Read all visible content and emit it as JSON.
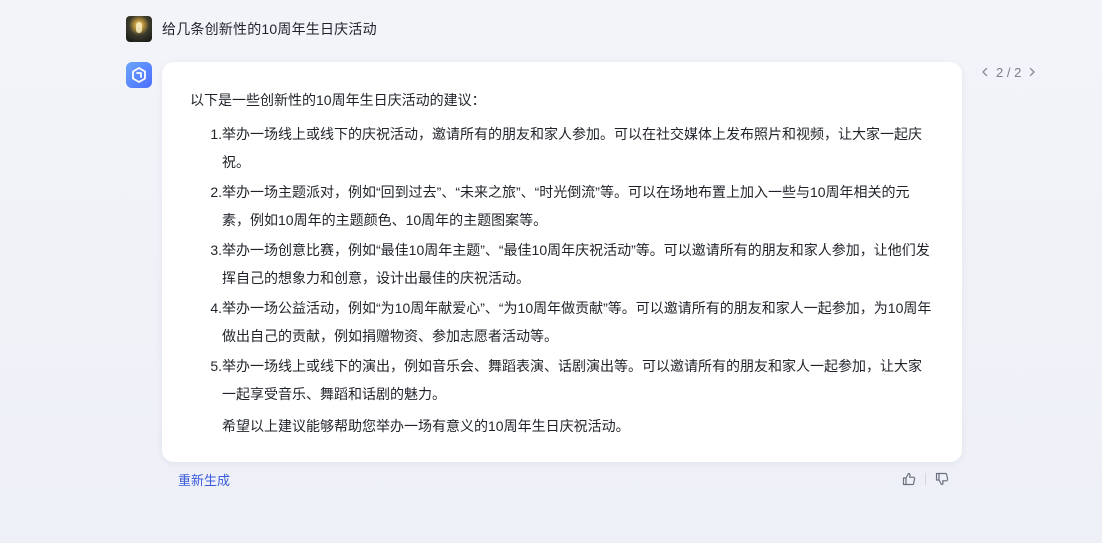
{
  "user_message": {
    "text": "给几条创新性的10周年生日庆活动"
  },
  "answer": {
    "intro": "以下是一些创新性的10周年生日庆活动的建议：",
    "items": [
      {
        "num": "1.",
        "text": "举办一场线上或线下的庆祝活动，邀请所有的朋友和家人参加。可以在社交媒体上发布照片和视频，让大家一起庆祝。"
      },
      {
        "num": "2.",
        "text": "举办一场主题派对，例如“回到过去”、“未来之旅”、“时光倒流”等。可以在场地布置上加入一些与10周年相关的元素，例如10周年的主题颜色、10周年的主题图案等。"
      },
      {
        "num": "3.",
        "text": "举办一场创意比赛，例如“最佳10周年主题”、“最佳10周年庆祝活动”等。可以邀请所有的朋友和家人参加，让他们发挥自己的想象力和创意，设计出最佳的庆祝活动。"
      },
      {
        "num": "4.",
        "text": "举办一场公益活动，例如“为10周年献爱心”、“为10周年做贡献”等。可以邀请所有的朋友和家人一起参加，为10周年做出自己的贡献，例如捐赠物资、参加志愿者活动等。"
      },
      {
        "num": "5.",
        "text": "举办一场线上或线下的演出，例如音乐会、舞蹈表演、话剧演出等。可以邀请所有的朋友和家人一起参加，让大家一起享受音乐、舞蹈和话剧的魅力。"
      }
    ],
    "closing": "希望以上建议能够帮助您举办一场有意义的10周年生日庆祝活动。"
  },
  "pager": {
    "prev_icon": "chevron-left-icon",
    "count": "2 / 2",
    "next_icon": "chevron-right-icon"
  },
  "actions": {
    "regenerate_label": "重新生成",
    "like_icon": "thumbs-up-icon",
    "dislike_icon": "thumbs-down-icon"
  },
  "colors": {
    "accent": "#3b5bdb",
    "bot_avatar": "#5b7cff",
    "background": "#f0f2f8",
    "card": "#ffffff"
  }
}
